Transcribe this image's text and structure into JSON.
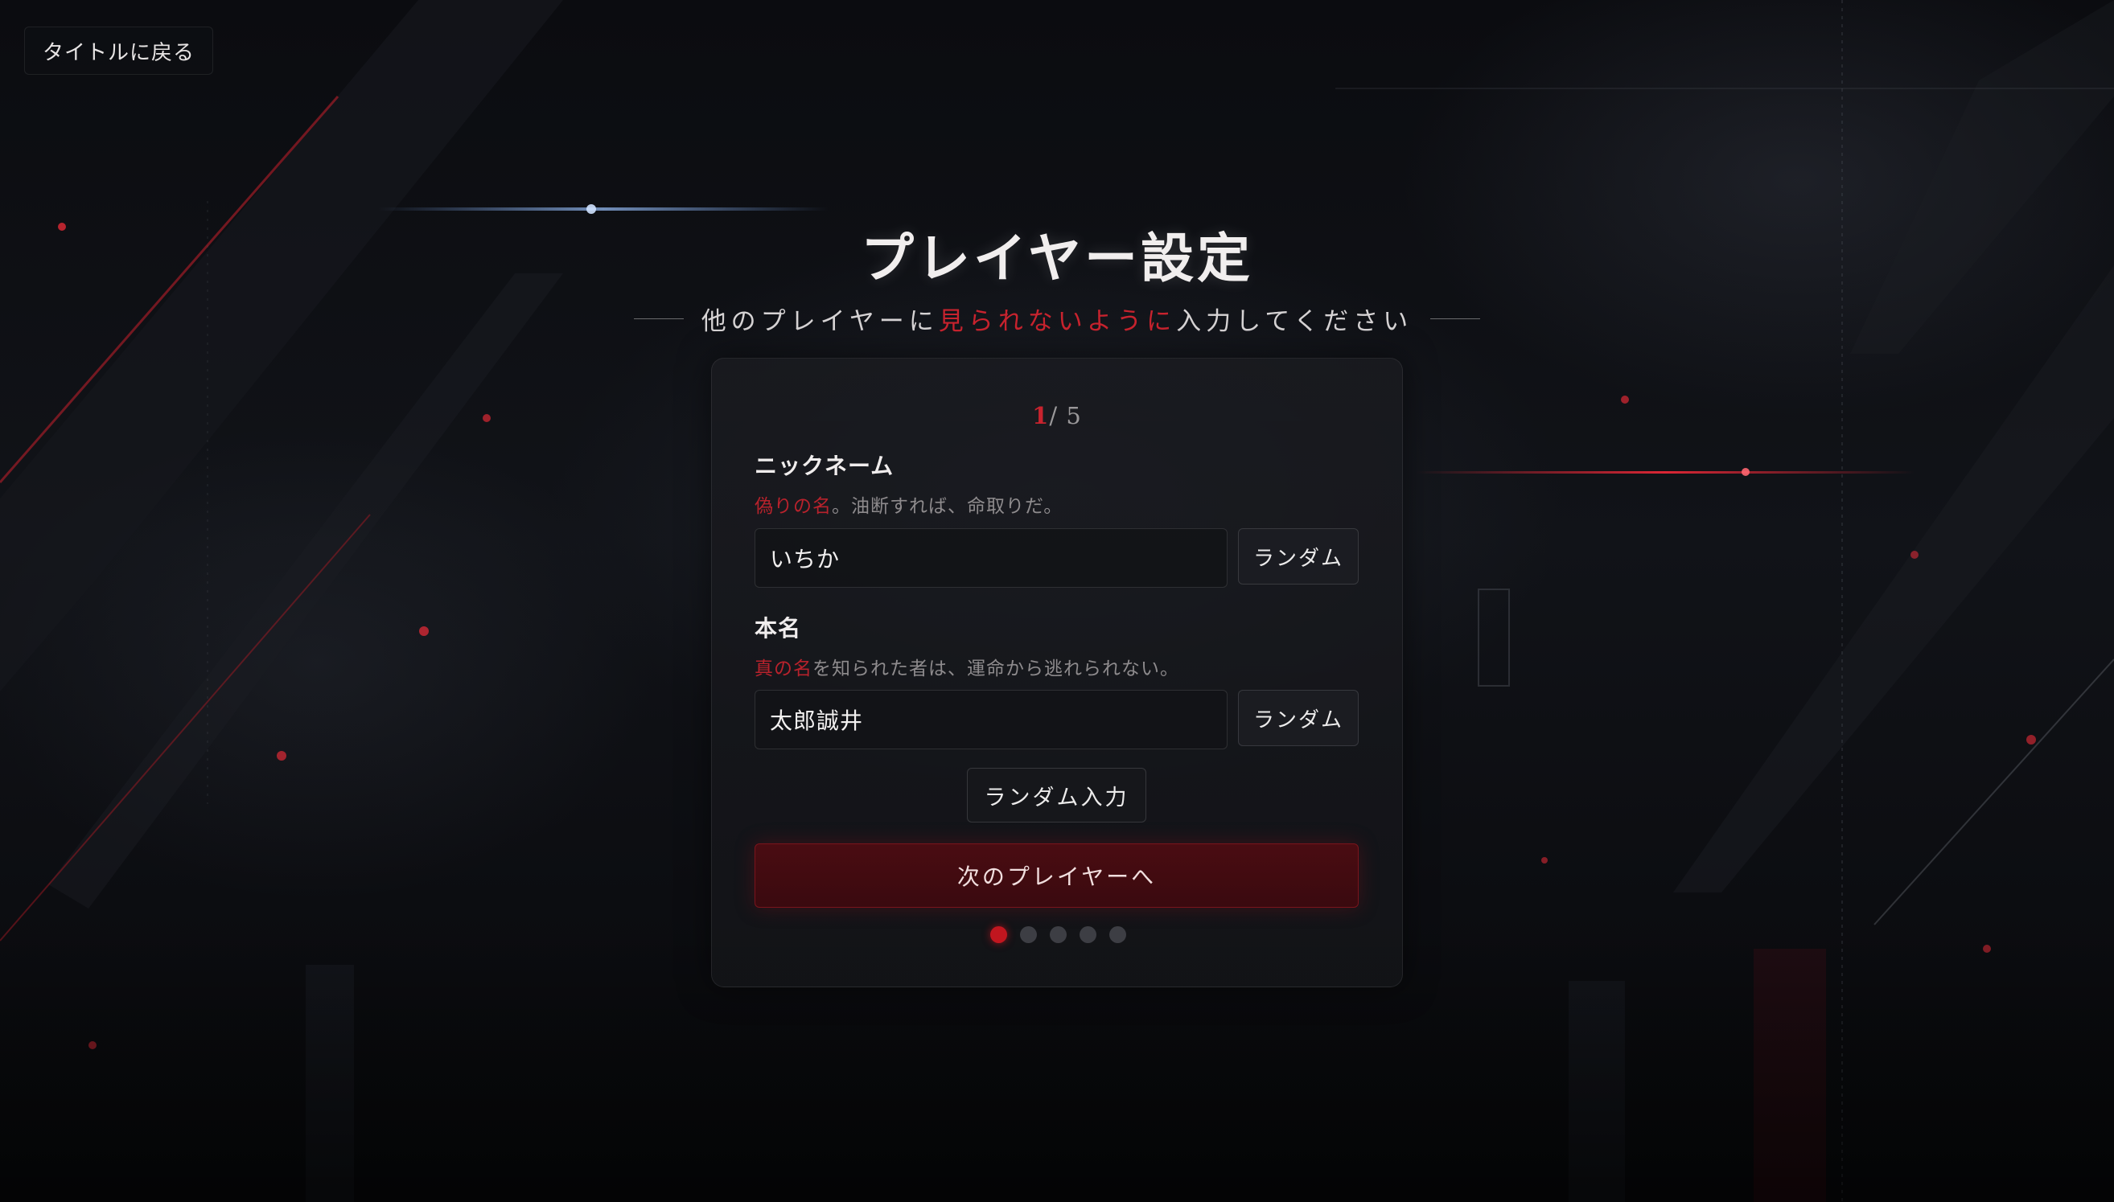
{
  "nav": {
    "back_label": "タイトルに戻る"
  },
  "header": {
    "title": "プレイヤー設定",
    "subtitle_before": "他のプレイヤーに",
    "subtitle_highlight": "見られないように",
    "subtitle_after": "入力してください"
  },
  "progress": {
    "current": "1",
    "total_text": "/ 5",
    "step": 1,
    "total": 5
  },
  "nickname": {
    "label": "ニックネーム",
    "hint_accent": "偽りの名",
    "hint_rest": "。油断すれば、命取りだ。",
    "value": "いちか",
    "random_label": "ランダム"
  },
  "realname": {
    "label": "本名",
    "hint_accent": "真の名",
    "hint_rest": "を知られた者は、運命から逃れられない。",
    "value": "太郎誠井",
    "random_label": "ランダム"
  },
  "actions": {
    "random_all_label": "ランダム入力",
    "next_label": "次のプレイヤーへ"
  },
  "colors": {
    "accent_red": "#c8232e",
    "next_button_bg": "#3a0a0f",
    "background": "#0a0b0e"
  }
}
